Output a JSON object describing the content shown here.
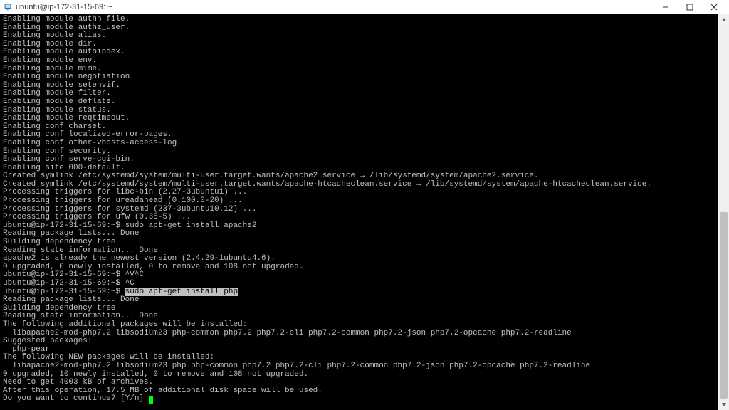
{
  "window": {
    "title": "ubuntu@ip-172-31-15-69: ~"
  },
  "terminal": {
    "lines": [
      "Enabling module authn_file.",
      "Enabling module authz_user.",
      "Enabling module alias.",
      "Enabling module dir.",
      "Enabling module autoindex.",
      "Enabling module env.",
      "Enabling module mime.",
      "Enabling module negotiation.",
      "Enabling module setenvif.",
      "Enabling module filter.",
      "Enabling module deflate.",
      "Enabling module status.",
      "Enabling module reqtimeout.",
      "Enabling conf charset.",
      "Enabling conf localized-error-pages.",
      "Enabling conf other-vhosts-access-log.",
      "Enabling conf security.",
      "Enabling conf serve-cgi-bin.",
      "Enabling site 000-default.",
      "Created symlink /etc/systemd/system/multi-user.target.wants/apache2.service → /lib/systemd/system/apache2.service.",
      "Created symlink /etc/systemd/system/multi-user.target.wants/apache-htcacheclean.service → /lib/systemd/system/apache-htcacheclean.service.",
      "Processing triggers for libc-bin (2.27-3ubuntu1) ...",
      "Processing triggers for ureadahead (0.100.0-20) ...",
      "Processing triggers for systemd (237-3ubuntu10.12) ...",
      "Processing triggers for ufw (0.35-5) ...",
      "ubuntu@ip-172-31-15-69:~$ sudo apt-get install apache2",
      "Reading package lists... Done",
      "Building dependency tree",
      "Reading state information... Done",
      "apache2 is already the newest version (2.4.29-1ubuntu4.6).",
      "0 upgraded, 0 newly installed, 0 to remove and 108 not upgraded.",
      "ubuntu@ip-172-31-15-69:~$ ^V^C",
      "ubuntu@ip-172-31-15-69:~$ ^C"
    ],
    "highlight_line": {
      "prefix": "ubuntu@ip-172-31-15-69:~$ ",
      "highlighted": "sudo apt-get install php"
    },
    "lines_after": [
      "Reading package lists... Done",
      "Building dependency tree",
      "Reading state information... Done",
      "The following additional packages will be installed:",
      "  libapache2-mod-php7.2 libsodium23 php-common php7.2 php7.2-cli php7.2-common php7.2-json php7.2-opcache php7.2-readline",
      "Suggested packages:",
      "  php-pear",
      "The following NEW packages will be installed:",
      "  libapache2-mod-php7.2 libsodium23 php php-common php7.2 php7.2-cli php7.2-common php7.2-json php7.2-opcache php7.2-readline",
      "0 upgraded, 10 newly installed, 0 to remove and 108 not upgraded.",
      "Need to get 4003 kB of archives.",
      "After this operation, 17.5 MB of additional disk space will be used.",
      "Do you want to continue? [Y/n] "
    ]
  },
  "scrollbar": {
    "thumb_top_pct": 50,
    "thumb_height_pct": 50
  }
}
